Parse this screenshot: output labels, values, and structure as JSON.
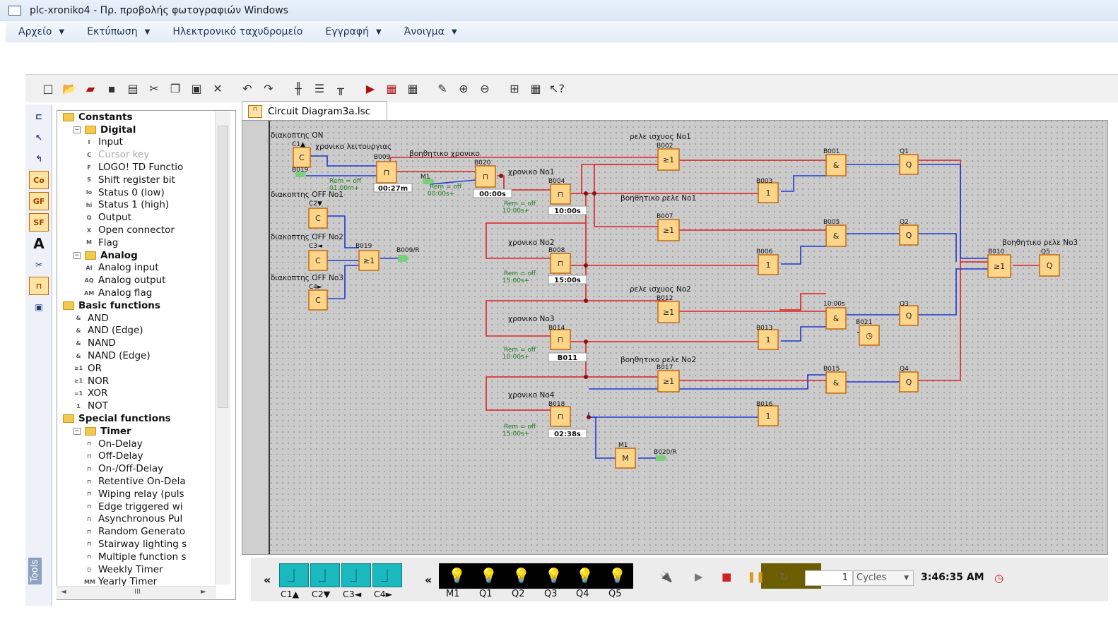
{
  "window": {
    "title": "plc-xroniko4 - Πρ. προβολής φωτογραφιών Windows"
  },
  "menu": [
    {
      "label": "Αρχείο",
      "dropdown": true
    },
    {
      "label": "Εκτύπωση",
      "dropdown": true
    },
    {
      "label": "Ηλεκτρονικό ταχυδρομείο",
      "dropdown": false
    },
    {
      "label": "Εγγραφή",
      "dropdown": true
    },
    {
      "label": "Άνοιγμα",
      "dropdown": true
    }
  ],
  "left_toolbar": {
    "items": [
      "Co",
      "GF",
      "SF"
    ],
    "tools_label": "Tools"
  },
  "tree": {
    "rows": [
      {
        "label": "Constants",
        "kind": "group",
        "bold": true,
        "indent": 0
      },
      {
        "label": "Digital",
        "kind": "group",
        "bold": true,
        "indent": 1
      },
      {
        "label": "Input",
        "icon": "I",
        "indent": 2
      },
      {
        "label": "Cursor key",
        "icon": "C",
        "indent": 2,
        "disabled": true
      },
      {
        "label": "LOGO! TD Functio",
        "icon": "F",
        "indent": 2
      },
      {
        "label": "Shift register bit",
        "icon": "S",
        "indent": 2
      },
      {
        "label": "Status 0 (low)",
        "icon": "lo",
        "indent": 2
      },
      {
        "label": "Status 1 (high)",
        "icon": "hi",
        "indent": 2
      },
      {
        "label": "Output",
        "icon": "Q",
        "indent": 2
      },
      {
        "label": "Open connector",
        "icon": "X",
        "indent": 2
      },
      {
        "label": "Flag",
        "icon": "M",
        "indent": 2
      },
      {
        "label": "Analog",
        "kind": "group",
        "bold": true,
        "indent": 1
      },
      {
        "label": "Analog input",
        "icon": "AI",
        "indent": 2
      },
      {
        "label": "Analog output",
        "icon": "AQ",
        "indent": 2
      },
      {
        "label": "Analog flag",
        "icon": "AM",
        "indent": 2
      },
      {
        "label": "Basic functions",
        "kind": "group",
        "bold": true,
        "indent": 0
      },
      {
        "label": "AND",
        "icon": "&",
        "indent": 1
      },
      {
        "label": "AND (Edge)",
        "icon": "&",
        "indent": 1
      },
      {
        "label": "NAND",
        "icon": "&",
        "indent": 1
      },
      {
        "label": "NAND (Edge)",
        "icon": "&",
        "indent": 1
      },
      {
        "label": "OR",
        "icon": "≥1",
        "indent": 1
      },
      {
        "label": "NOR",
        "icon": "≥1",
        "indent": 1
      },
      {
        "label": "XOR",
        "icon": "=1",
        "indent": 1
      },
      {
        "label": "NOT",
        "icon": "1",
        "indent": 1
      },
      {
        "label": "Special functions",
        "kind": "group",
        "bold": true,
        "indent": 0
      },
      {
        "label": "Timer",
        "kind": "group",
        "bold": true,
        "indent": 1
      },
      {
        "label": "On-Delay",
        "icon": "⊓",
        "indent": 2
      },
      {
        "label": "Off-Delay",
        "icon": "⊓",
        "indent": 2
      },
      {
        "label": "On-/Off-Delay",
        "icon": "⊓",
        "indent": 2
      },
      {
        "label": "Retentive On-Dela",
        "icon": "⊓",
        "indent": 2
      },
      {
        "label": "Wiping relay (puls",
        "icon": "⊓",
        "indent": 2
      },
      {
        "label": "Edge triggered wi",
        "icon": "⊓",
        "indent": 2
      },
      {
        "label": "Asynchronous Pul",
        "icon": "⊓",
        "indent": 2
      },
      {
        "label": "Random Generato",
        "icon": "⊓",
        "indent": 2
      },
      {
        "label": "Stairway lighting s",
        "icon": "⊓",
        "indent": 2
      },
      {
        "label": "Multiple function s",
        "icon": "⊓",
        "indent": 2
      },
      {
        "label": "Weekly Timer",
        "icon": "◷",
        "indent": 2
      },
      {
        "label": "Yearly Timer",
        "icon": "MM",
        "indent": 2
      }
    ],
    "hscroll_text": "III"
  },
  "tab": {
    "label": "Circuit Diagram3a.lsc"
  },
  "diagram": {
    "labels": [
      "διακοπτης ON",
      "C1▲",
      "χρονικο λειτουργιας",
      "B009",
      "B019",
      "Rem = off",
      "01:00m+",
      "βοηθητικο χρονικο",
      "B020",
      "M1",
      "Rem = off",
      "00:00s+",
      "00:27m",
      "00:00s",
      "χρονικο No1",
      "B004",
      "Rem = off",
      "10:00s+",
      "10:00s",
      "διακοπτης OFF No1",
      "C2▼",
      "διακοπτης OFF No2",
      "C3◄",
      "B019",
      "B009/R",
      "διακοπτης OFF No3",
      "C4►",
      "ρελε ισχυος No1",
      "B002",
      "B001",
      "Q1",
      "B003",
      "βοηθητικο ρελε No1",
      "B007",
      "χρονικο No2",
      "B008",
      "Rem = off",
      "15:00s+",
      "15:00s",
      "B005",
      "Q2",
      "B006",
      "βοηθητικο ρελε No3",
      "B010",
      "Q5",
      "ρελε ισχυος No2",
      "B012",
      "χρονικο No3",
      "B014",
      "Rem = off",
      "10:00s+",
      "10:00s",
      "B011",
      "Q3",
      "B013",
      "B021",
      "βοηθητικο ρελε No2",
      "B017",
      "B015",
      "Q4",
      "χρονικο No4",
      "B018",
      "Rem = off",
      "15:00s+",
      "02:38s",
      "B016",
      "M1",
      "B020/R"
    ]
  },
  "sim": {
    "collapse_glyph": "«",
    "switches": [
      "C1▲",
      "C2▼",
      "C3◄",
      "C4►"
    ],
    "lamps": [
      {
        "name": "M1",
        "on": false
      },
      {
        "name": "Q1",
        "on": false
      },
      {
        "name": "Q2",
        "on": false
      },
      {
        "name": "Q3",
        "on": false
      },
      {
        "name": "Q4",
        "on": true
      },
      {
        "name": "Q5",
        "on": true
      }
    ],
    "cycles_value": "1",
    "cycles_label": "Cycles",
    "time": "3:46:35 AM"
  }
}
